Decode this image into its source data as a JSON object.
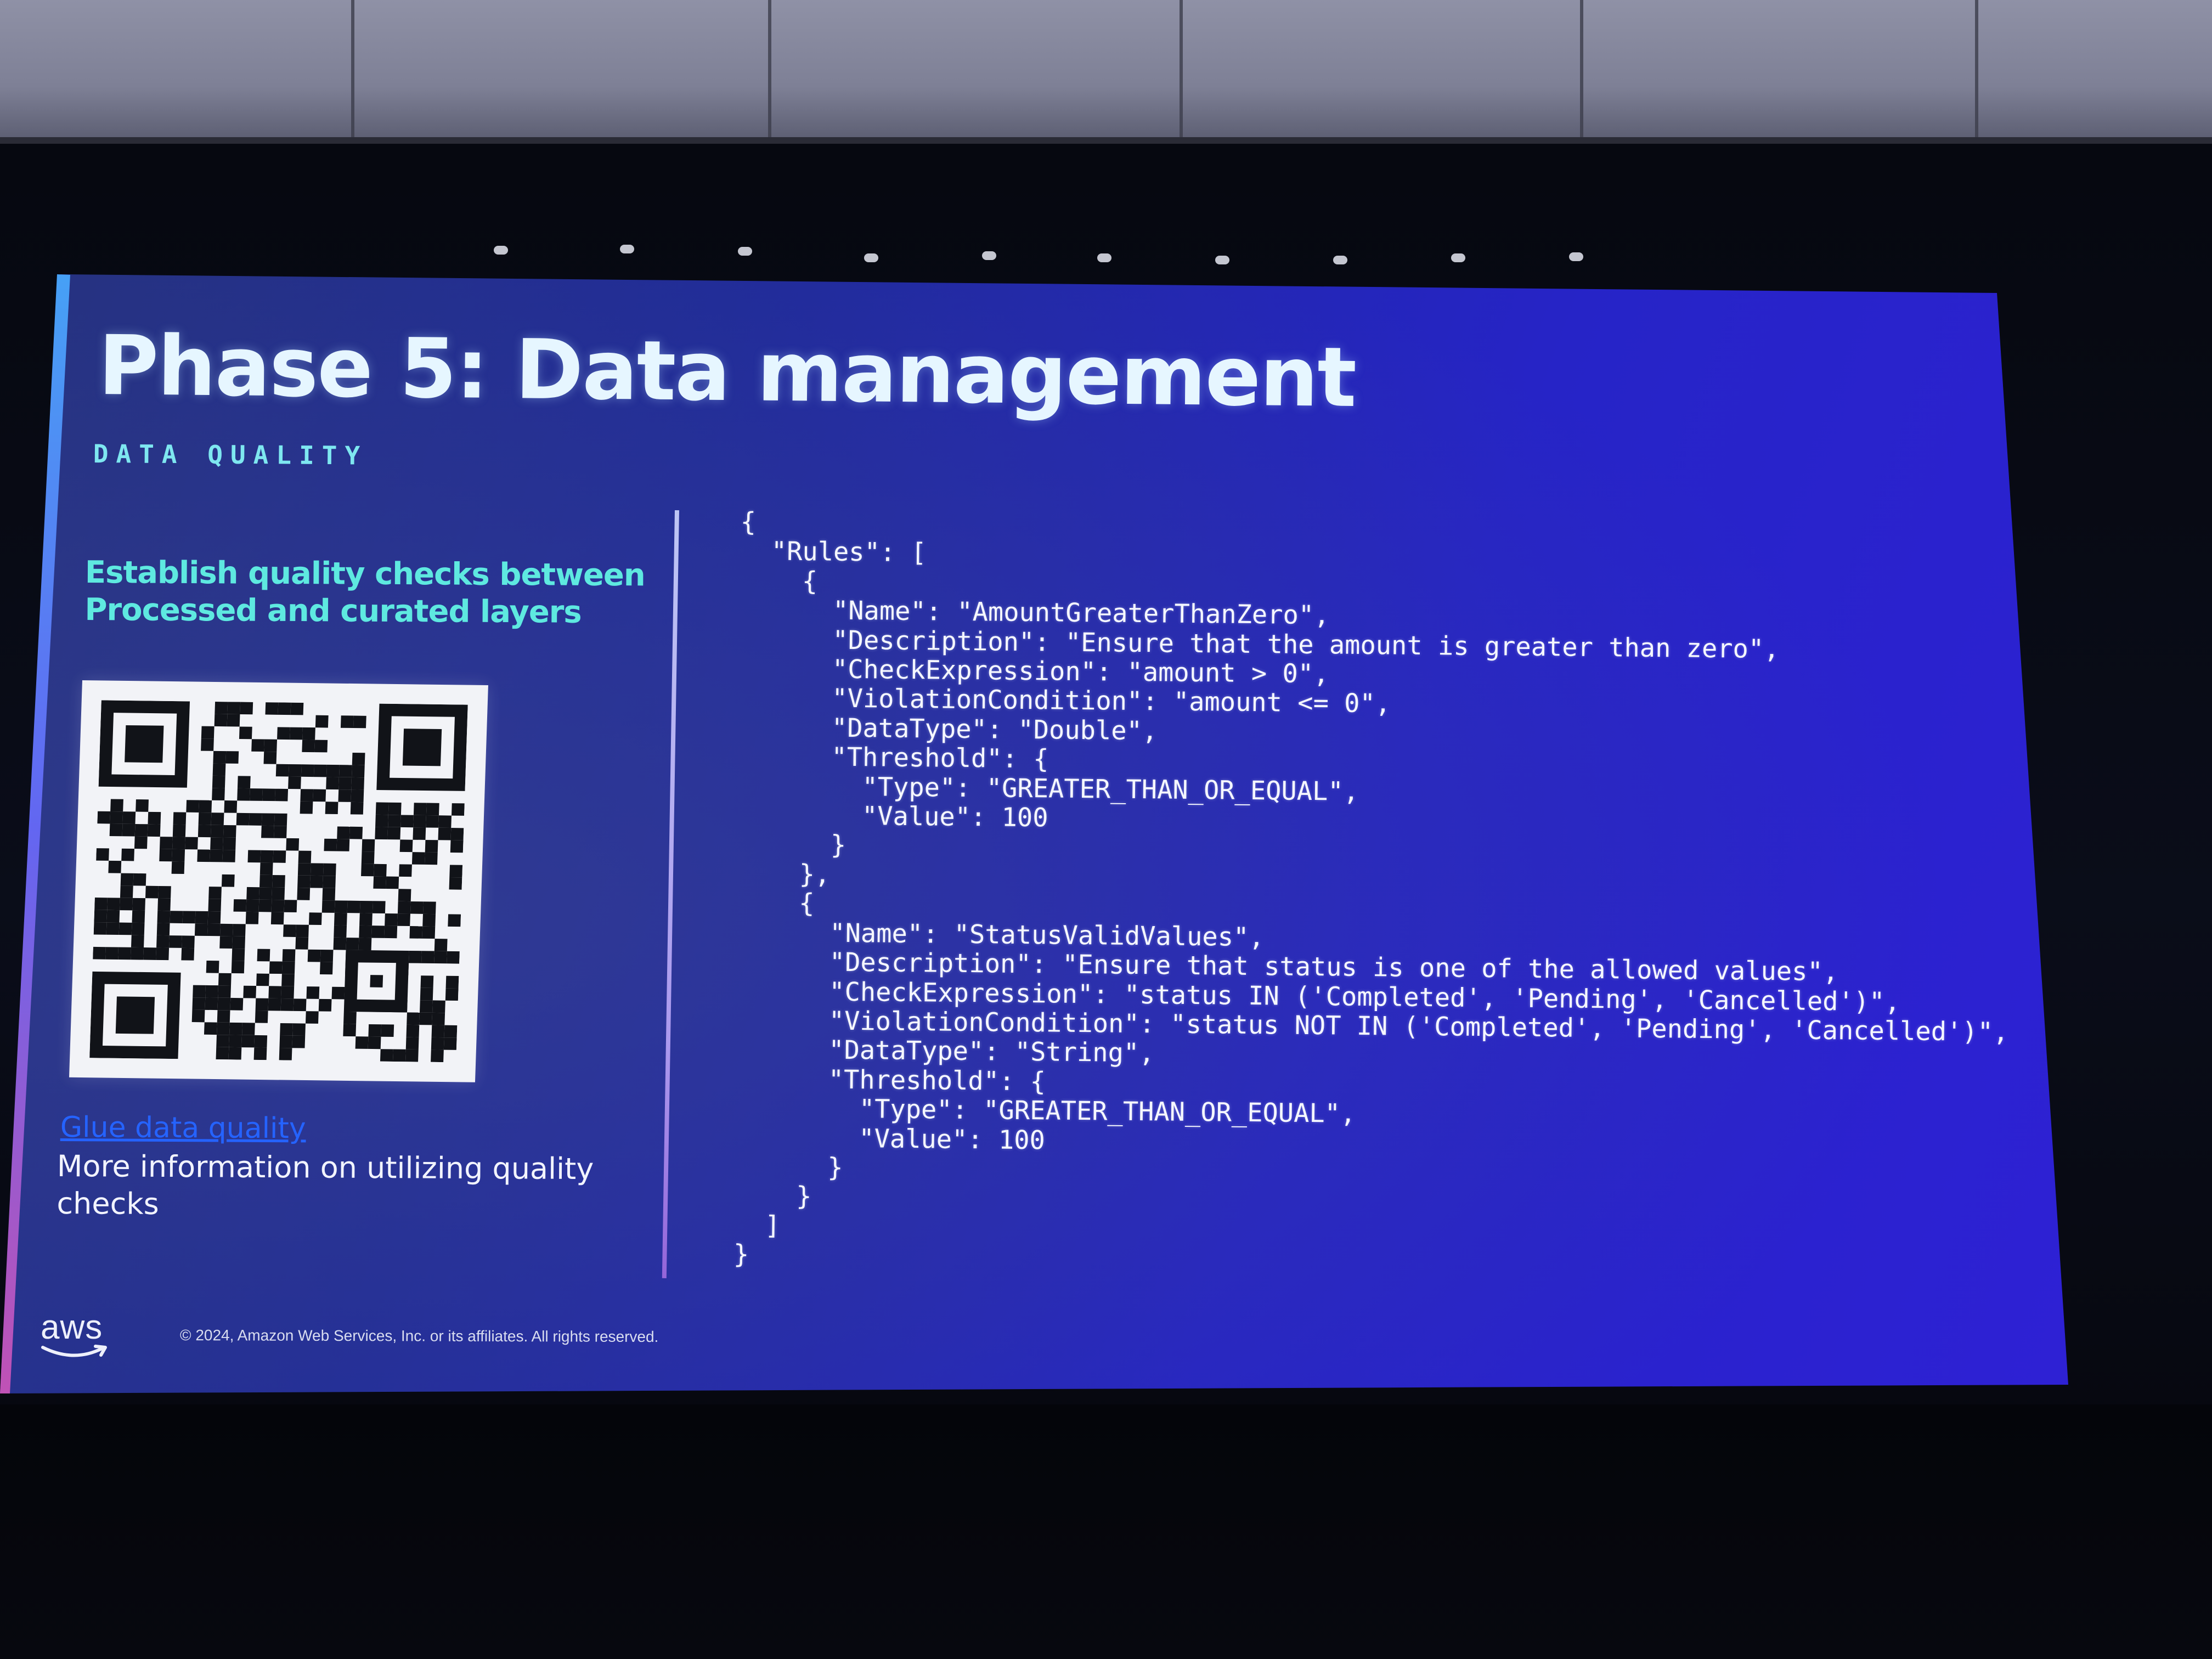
{
  "slide": {
    "title": "Phase 5: Data management",
    "subtitle": "DATA QUALITY",
    "lead_line1": "Establish quality checks between",
    "lead_line2": "Processed and curated layers",
    "link_text": "Glue data quality",
    "link_desc": "More information on utilizing quality checks",
    "logo_text": "aws",
    "copyright": "© 2024, Amazon Web Services, Inc. or its affiliates. All rights reserved.",
    "code": "{\n  \"Rules\": [\n    {\n      \"Name\": \"AmountGreaterThanZero\",\n      \"Description\": \"Ensure that the amount is greater than zero\",\n      \"CheckExpression\": \"amount > 0\",\n      \"ViolationCondition\": \"amount <= 0\",\n      \"DataType\": \"Double\",\n      \"Threshold\": {\n        \"Type\": \"GREATER_THAN_OR_EQUAL\",\n        \"Value\": 100\n      }\n    },\n    {\n      \"Name\": \"StatusValidValues\",\n      \"Description\": \"Ensure that status is one of the allowed values\",\n      \"CheckExpression\": \"status IN ('Completed', 'Pending', 'Cancelled')\",\n      \"ViolationCondition\": \"status NOT IN ('Completed', 'Pending', 'Cancelled')\",\n      \"DataType\": \"String\",\n      \"Threshold\": {\n        \"Type\": \"GREATER_THAN_OR_EQUAL\",\n        \"Value\": 100\n      }\n    }\n  ]\n}"
  },
  "colors": {
    "slide_bg_start": "#25327a",
    "slide_bg_end": "#3020d8",
    "title": "#e6f6ff",
    "subtitle": "#7ee7f0",
    "lead": "#5ee9e0",
    "link": "#2563ff",
    "code": "#f5f7ff"
  },
  "icons": {
    "qr": "qr-code-icon",
    "logo": "aws-logo-icon"
  }
}
